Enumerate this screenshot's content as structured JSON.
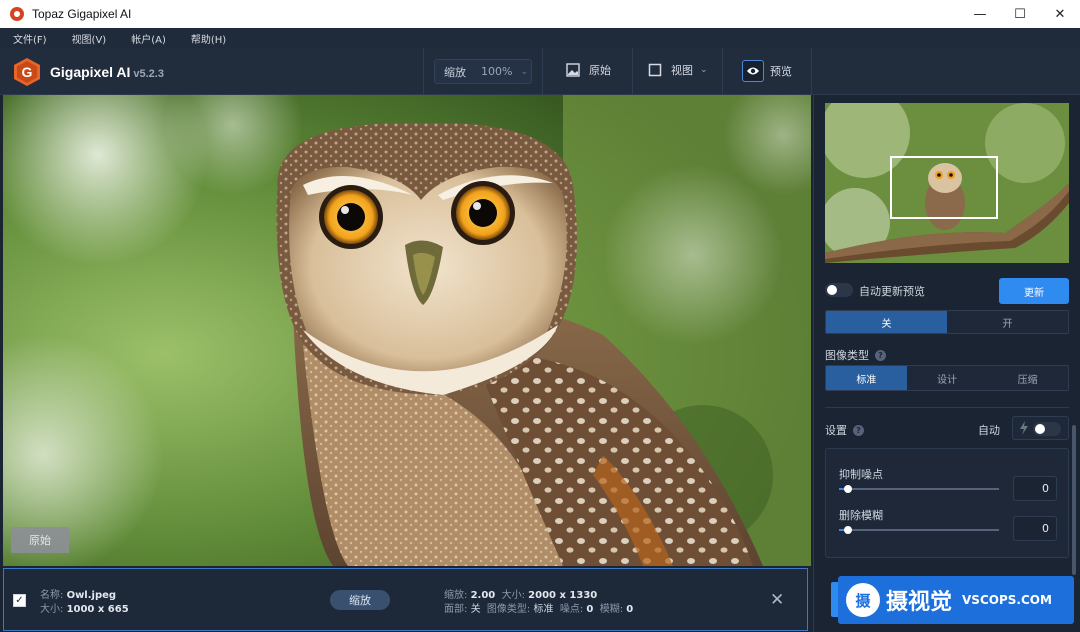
{
  "window": {
    "title": "Topaz Gigapixel AI",
    "controls": {
      "minimize": "—",
      "maximize": "☐",
      "close": "✕"
    }
  },
  "menu": [
    "文件(F)",
    "视图(V)",
    "帐户(A)",
    "帮助(H)"
  ],
  "toolbar": {
    "brand": "Gigapixel AI",
    "version": "v5.2.3",
    "zoom_label": "缩放",
    "zoom_value": "100%",
    "original_label": "原始",
    "view_label": "视图",
    "preview_label": "预览"
  },
  "viewer": {
    "original_button": "原始"
  },
  "filebar": {
    "checked": true,
    "name_label": "名称:",
    "name_value": "Owl.jpeg",
    "size_label": "大小:",
    "size_value": "1000 x 665",
    "scale_button": "缩放",
    "out_scale_label": "缩放:",
    "out_scale_value": "2.00",
    "out_size_label": "大小:",
    "out_size_value": "2000 x 1330",
    "face_label": "面部:",
    "face_value": "关",
    "type_label": "图像类型:",
    "type_value": "标准",
    "noise_label": "噪点:",
    "noise_value": "0",
    "blur_label": "模糊:",
    "blur_value": "0"
  },
  "panel": {
    "auto_update_label": "自动更新预览",
    "auto_update_on": false,
    "update_button": "更新",
    "face_options": [
      "关",
      "开"
    ],
    "face_selected": "关",
    "image_type_label": "图像类型",
    "image_type_options": [
      "标准",
      "设计",
      "压缩"
    ],
    "image_type_selected": "标准",
    "settings_label": "设置",
    "auto_label": "自动",
    "auto_on": false,
    "suppress_noise_label": "抑制噪点",
    "suppress_noise_value": "0",
    "remove_blur_label": "删除模糊",
    "remove_blur_value": "0"
  },
  "watermark": {
    "seal": "摄",
    "text": "摄视觉",
    "site": "VSCOPS.COM"
  },
  "colors": {
    "accent": "#2f8bf0",
    "panel": "#1b2433",
    "toolbar": "#212c3d"
  }
}
